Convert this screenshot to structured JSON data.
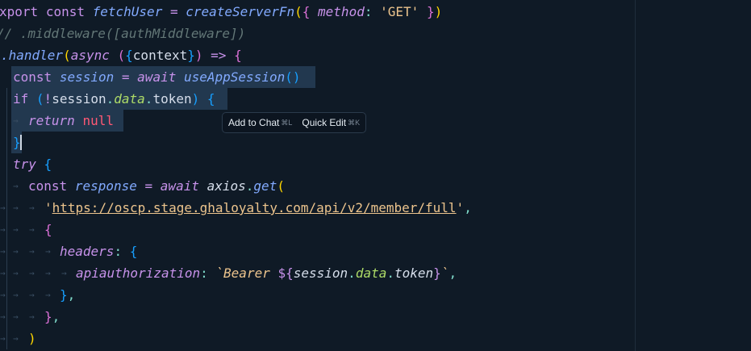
{
  "popup": {
    "add_to_chat": "Add to Chat",
    "add_to_chat_kbd": "⌘L",
    "quick_edit": "Quick Edit",
    "quick_edit_kbd": "⌘K"
  },
  "code": {
    "l1": [
      "xport",
      " ",
      "const",
      " ",
      "fetchUser",
      " ",
      "=",
      " ",
      "createServerFn",
      "(",
      "{",
      " ",
      "method",
      ":",
      " ",
      "'",
      "GET",
      "'",
      " ",
      "}",
      ")"
    ],
    "l2": "// .middleware([authMiddleware])",
    "l3": [
      ".handler",
      "(",
      "async",
      " ",
      "(",
      "{",
      "context",
      "}",
      ")",
      " ",
      "=>",
      " ",
      "{"
    ],
    "l4": [
      "const",
      " ",
      "session",
      " ",
      "=",
      " ",
      "await",
      " ",
      "useAppSession",
      "(",
      ")"
    ],
    "l5": [
      "if",
      " ",
      "(",
      "!",
      "session",
      ".",
      "data",
      ".",
      "token",
      ")",
      " ",
      "{"
    ],
    "l6": [
      "return",
      " ",
      "null"
    ],
    "l7": "}",
    "l8": [
      "try",
      " ",
      "{"
    ],
    "l9": [
      "const",
      " ",
      "response",
      " ",
      "=",
      " ",
      "await",
      " ",
      "axios",
      ".",
      "get",
      "("
    ],
    "l10": [
      "'",
      "https://oscp.stage.ghaloyalty.com/api/v2/member/full",
      "'",
      ","
    ],
    "l11": "{",
    "l12": [
      "headers",
      ":",
      " ",
      "{"
    ],
    "l13": [
      "apiauthorization",
      ":",
      " ",
      "`Bearer ",
      "${",
      "session",
      ".",
      "data",
      ".",
      "token",
      "}",
      "`",
      ","
    ],
    "l14": [
      "}",
      ","
    ],
    "l15": [
      "}",
      ","
    ],
    "l16": ")"
  }
}
